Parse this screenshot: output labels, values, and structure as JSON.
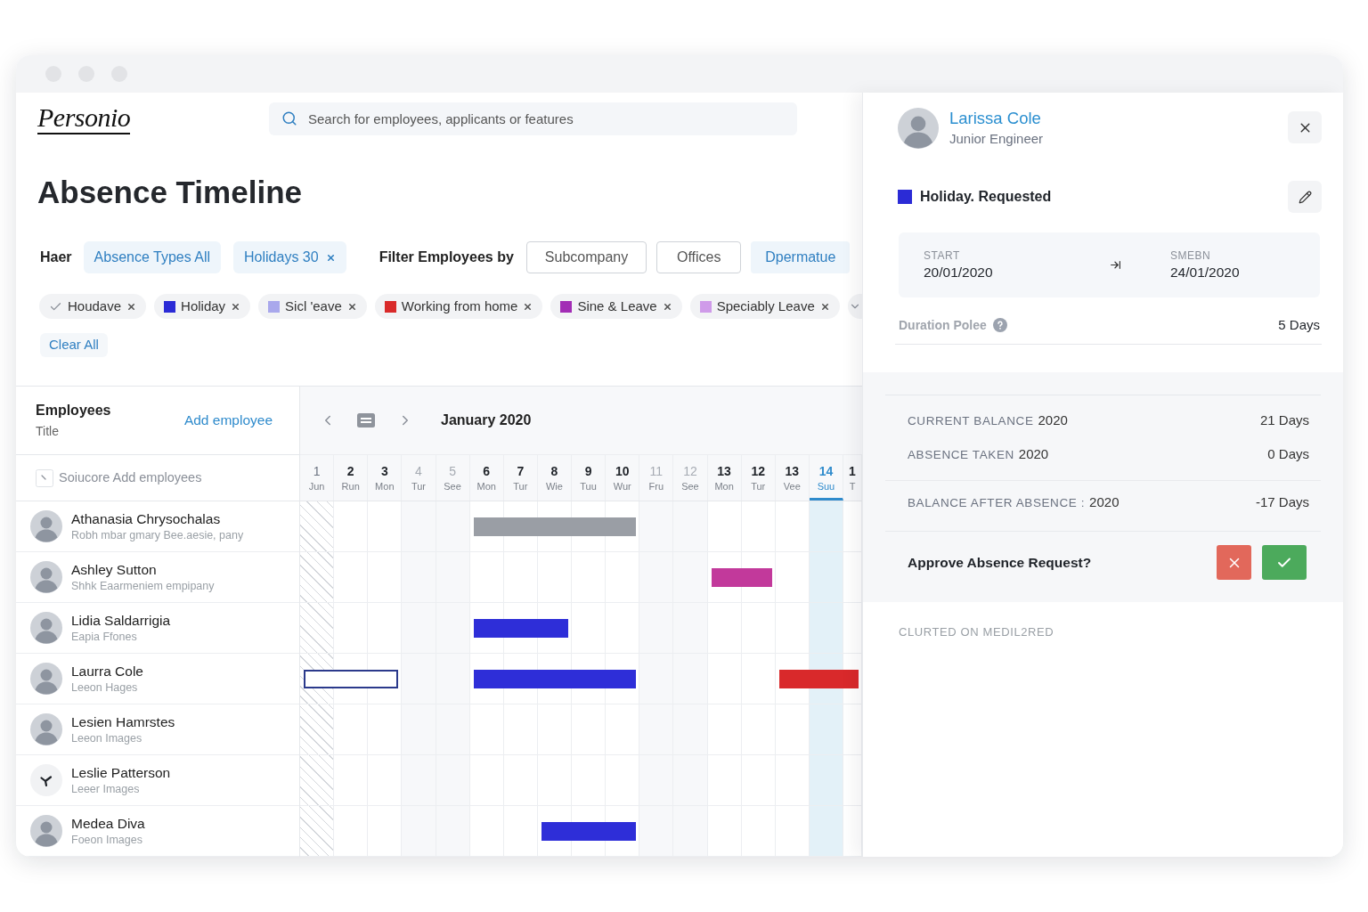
{
  "header": {
    "logo": "Personio",
    "search": {
      "placeholder": "Search for employees, applicants or features"
    }
  },
  "page_title": "Absence Timeline",
  "filters": {
    "label": "Haer",
    "chips": [
      {
        "label": "Absence Types All",
        "removable": false
      },
      {
        "label": "Holidays 30",
        "removable": true
      }
    ],
    "employee_filter_label": "Filter Employees by",
    "employee_filters": [
      {
        "label": "Subcompany",
        "selected": false
      },
      {
        "label": "Offices",
        "selected": false
      },
      {
        "label": "Dpermatue",
        "selected": true
      }
    ]
  },
  "absence_types": [
    {
      "label": "Houdave",
      "kind": "check"
    },
    {
      "label": "Holiday",
      "kind": "swatch",
      "color": "#2b2bd6"
    },
    {
      "label": "Sicl 'eave",
      "kind": "swatch",
      "color": "#a9a8ec"
    },
    {
      "label": "Working from home",
      "kind": "swatch",
      "color": "#d92a2a"
    },
    {
      "label": "Sine & Leave",
      "kind": "swatch",
      "color": "#a22db5"
    },
    {
      "label": "Speciably Leave",
      "kind": "swatch",
      "color": "#cf9be9"
    }
  ],
  "clear_all": "Clear All",
  "timeline": {
    "employees_heading": "Employees",
    "employees_subheading": "Title",
    "add_employee": "Add employee",
    "month": "January 2020",
    "employee_search": {
      "placeholder": "Soiucore Add employees"
    },
    "days": [
      {
        "number": "1",
        "weekday": "Jun",
        "kind": "holiday",
        "selected": false
      },
      {
        "number": "2",
        "weekday": "Run",
        "kind": "workday",
        "selected": false
      },
      {
        "number": "3",
        "weekday": "Mon",
        "kind": "workday",
        "selected": false
      },
      {
        "number": "4",
        "weekday": "Tur",
        "kind": "weekend",
        "selected": false
      },
      {
        "number": "5",
        "weekday": "See",
        "kind": "weekend",
        "selected": false
      },
      {
        "number": "6",
        "weekday": "Mon",
        "kind": "workday",
        "selected": false
      },
      {
        "number": "7",
        "weekday": "Tur",
        "kind": "workday",
        "selected": false
      },
      {
        "number": "8",
        "weekday": "Wie",
        "kind": "workday",
        "selected": false
      },
      {
        "number": "9",
        "weekday": "Tuu",
        "kind": "workday",
        "selected": false
      },
      {
        "number": "10",
        "weekday": "Wur",
        "kind": "workday",
        "selected": false
      },
      {
        "number": "11",
        "weekday": "Fru",
        "kind": "weekend",
        "selected": false
      },
      {
        "number": "12",
        "weekday": "See",
        "kind": "weekend",
        "selected": false
      },
      {
        "number": "13",
        "weekday": "Mon",
        "kind": "workday",
        "selected": false
      },
      {
        "number": "12",
        "weekday": "Tur",
        "kind": "workday",
        "selected": false
      },
      {
        "number": "13",
        "weekday": "Vee",
        "kind": "workday",
        "selected": false
      },
      {
        "number": "14",
        "weekday": "Suu",
        "kind": "workday",
        "selected": true
      },
      {
        "number": "1",
        "weekday": "T",
        "kind": "workday",
        "selected": false
      }
    ],
    "employees": [
      {
        "name": "Athanasia Chrysochalas",
        "title": "Robh mbar gmary Bee.aesie, pany",
        "avatar": {
          "kind": "photo"
        },
        "absences": [
          {
            "kind": "filled",
            "color": "#9a9ea5"
          }
        ]
      },
      {
        "name": "Ashley Sutton",
        "title": "Shhk Eaarmeniem empipany",
        "avatar": {
          "kind": "photo"
        },
        "absences": [
          {
            "kind": "filled",
            "color": "#c2399b"
          }
        ]
      },
      {
        "name": "Lidia Saldarrigia",
        "title": "Eapia Ffones",
        "avatar": {
          "kind": "photo"
        },
        "absences": [
          {
            "kind": "filled",
            "color": "#2e2ed8"
          }
        ]
      },
      {
        "name": "Laurra Cole",
        "title": "Leeon Hages",
        "avatar": {
          "kind": "photo"
        },
        "absences": [
          {
            "kind": "outlined",
            "color": "#2b3a8c"
          },
          {
            "kind": "filled",
            "color": "#2e2ed8"
          },
          {
            "kind": "filled",
            "color": "#d9292b"
          }
        ]
      },
      {
        "name": "Lesien Hamrstes",
        "title": "Leeon Images",
        "avatar": {
          "kind": "photo"
        }
      },
      {
        "name": "Leslie Patterson",
        "title": "Leeer Images",
        "avatar": {
          "kind": "icon"
        }
      },
      {
        "name": "Medea Diva",
        "title": "Foeon Images",
        "avatar": {
          "kind": "photo"
        },
        "absences": [
          {
            "kind": "filled",
            "color": "#2e2ed8"
          }
        ]
      }
    ]
  },
  "detail_panel": {
    "employee": {
      "name": "Larissa Cole",
      "role": "Junior Engineer",
      "avatar": {
        "kind": "photo"
      }
    },
    "absence": {
      "label": "Holiday. Requested",
      "color": "#2b2bd6"
    },
    "start": {
      "label": "START",
      "value": "20/01/2020"
    },
    "end": {
      "label": "SMEBN",
      "value": "24/01/2020"
    },
    "duration": {
      "label": "Duration Polee",
      "value": "5 Days"
    },
    "balances": [
      {
        "label": "CURRENT BALANCE",
        "year": "2020",
        "value": "21 Days",
        "kind": "line"
      },
      {
        "label": "ABSENCE TAKEN",
        "year": "2020",
        "value": "0 Days",
        "kind": "line"
      },
      {
        "label": "BALANCE AFTER ABSENCE :",
        "year": "2020",
        "value": "-17 Days",
        "kind": "total"
      }
    ],
    "approve_prompt": "Approve Absence Request?",
    "footer": "CLURTED ON MEDIL2RED"
  }
}
